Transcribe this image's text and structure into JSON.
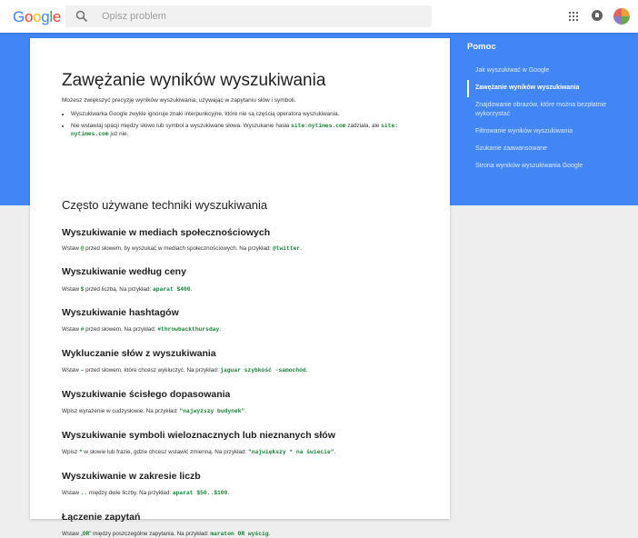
{
  "header": {
    "logo": [
      "G",
      "o",
      "o",
      "g",
      "l",
      "e"
    ],
    "search_placeholder": "Opisz problem"
  },
  "nav": {
    "title": "Pomoc",
    "items": [
      {
        "label": "Jak wyszukiwać w Google",
        "active": false
      },
      {
        "label": "Zawężanie wyników wyszukiwania",
        "active": true
      },
      {
        "label": "Znajdowanie obrazów, które można bezpłatnie wykorzystać",
        "active": false
      },
      {
        "label": "Filtrowanie wyników wyszukiwania",
        "active": false
      },
      {
        "label": "Szukanie zaawansowane",
        "active": false
      },
      {
        "label": "Strona wyników wyszukiwania Google",
        "active": false
      }
    ]
  },
  "article": {
    "title": "Zawężanie wyników wyszukiwania",
    "intro": "Możesz zwiększyć precyzję wyników wyszukiwania, używając w zapytaniu słów i symboli.",
    "bullets": {
      "b1": "Wyszukiwarka Google zwykle ignoruje znaki interpunkcyjne, które nie są częścią operatora wyszukiwania.",
      "b2_pre": "Nie wstawiaj spacji między słowo lub symbol a wyszukiwane słowa. Wyszukanie hasła ",
      "b2_code1": "site:nytimes.com",
      "b2_mid": " zadziała, ale ",
      "b2_code2": "site: nytimes.com",
      "b2_post": " już nie."
    },
    "subtitle": "Często używane techniki wyszukiwania",
    "sections": [
      {
        "title": "Wyszukiwanie w mediach społecznościowych",
        "pre": "Wstaw ",
        "sym": "@",
        "mid": " przed słowem, by wyszukać w mediach społecznościowych. Na przykład: ",
        "example": "@twitter",
        "post": "."
      },
      {
        "title": "Wyszukiwanie według ceny",
        "pre": "Wstaw ",
        "sym": "$",
        "mid": " przed liczbą. Na przykład: ",
        "example": "aparat $400",
        "post": "."
      },
      {
        "title": "Wyszukiwanie hashtagów",
        "pre": "Wstaw ",
        "sym": "#",
        "mid": " przed słowem. Na przykład: ",
        "example": "#throwbackthursday",
        "post": "."
      },
      {
        "title": "Wykluczanie słów z wyszukiwania",
        "pre": "Wstaw ",
        "sym": "–",
        "mid": " przed słowem, które chcesz wykluczyć. Na przykład: ",
        "example": "jaguar szybkość -samochód",
        "post": "."
      },
      {
        "title": "Wyszukiwanie ścisłego dopasowania",
        "pre": "Wpisz wyrażenie w cudzysłowie. Na przykład: ",
        "sym": "",
        "mid": "",
        "example": "\"najwyższy budynek\"",
        "post": "."
      },
      {
        "title": "Wyszukiwanie symboli wieloznacznych lub nieznanych słów",
        "pre": "Wpisz ",
        "sym": "*",
        "mid": " w słowie lub frazie, gdzie chcesz wstawić zmienną. Na przykład: ",
        "example": "\"największy * na świecie\"",
        "post": "."
      },
      {
        "title": "Wyszukiwanie w zakresie liczb",
        "pre": "Wstaw ",
        "sym": "..",
        "mid": " między dwie liczby. Na przykład: ",
        "example": "aparat $50..$100",
        "post": "."
      },
      {
        "title": "Łączenie zapytań",
        "pre": "Wstaw „",
        "sym": "OR",
        "mid": "” między poszczególne zapytania. Na przykład: ",
        "example": "maraton OR wyścig",
        "post": "."
      }
    ]
  }
}
